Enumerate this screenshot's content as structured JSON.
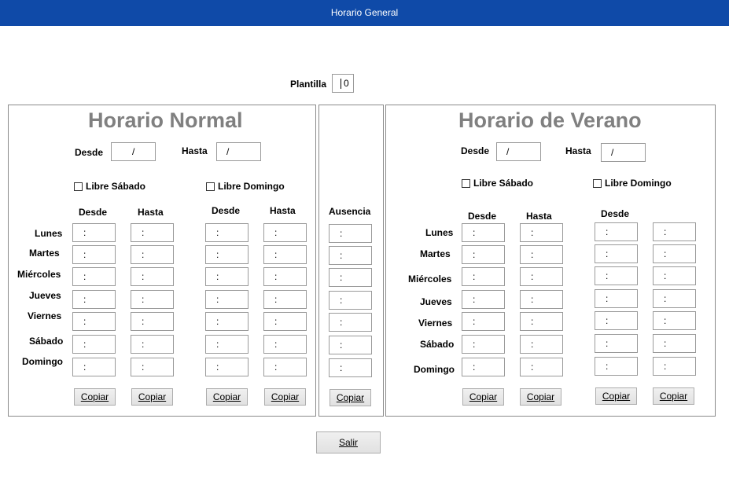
{
  "window": {
    "title": "Horario General"
  },
  "plantilla": {
    "label": "Plantilla",
    "value": "0"
  },
  "normal": {
    "title": "Horario Normal",
    "desde_label": "Desde",
    "desde_value": "/",
    "hasta_label": "Hasta",
    "hasta_value": "/",
    "libre_sabado": "Libre Sábado",
    "libre_domingo": "Libre Domingo",
    "col_headers": [
      "Desde",
      "Hasta",
      "Desde",
      "Hasta"
    ],
    "days": [
      "Lunes",
      "Martes",
      "Miércoles",
      "Jueves",
      "Viernes",
      "Sábado",
      "Domingo"
    ],
    "time_value": ":",
    "copy_label": "Copiar"
  },
  "ausencia": {
    "header": "Ausencia",
    "time_value": ":",
    "copy_label": "Copiar"
  },
  "verano": {
    "title": "Horario de Verano",
    "desde_label": "Desde",
    "desde_value": "/",
    "hasta_label": "Hasta",
    "hasta_value": "/",
    "libre_sabado": "Libre Sábado",
    "libre_domingo": "Libre Domingo",
    "col_headers": [
      "Desde",
      "Hasta",
      "Desde"
    ],
    "days": [
      "Lunes",
      "Martes",
      "Miércoles",
      "Jueves",
      "Viernes",
      "Sábado",
      "Domingo"
    ],
    "time_value": ":",
    "copy_label": "Copiar"
  },
  "salir": {
    "label": "Salir"
  }
}
